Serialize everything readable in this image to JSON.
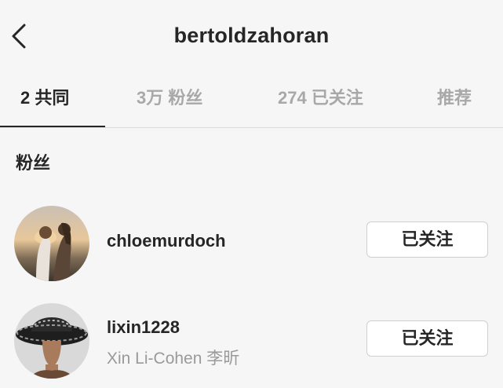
{
  "header": {
    "title": "bertoldzahoran",
    "back_icon": "chevron-left-icon"
  },
  "tabs": [
    {
      "label": "2 共同",
      "active": true
    },
    {
      "label": "3万 粉丝",
      "active": false
    },
    {
      "label": "274 已关注",
      "active": false
    },
    {
      "label": "推荐",
      "active": false
    }
  ],
  "section": {
    "title": "粉丝"
  },
  "users": [
    {
      "username": "chloemurdoch",
      "full_name": "",
      "button_label": "已关注"
    },
    {
      "username": "lixin1228",
      "full_name": "Xin Li-Cohen 李昕",
      "button_label": "已关注"
    }
  ],
  "colors": {
    "background": "#f6f6f6",
    "primary_text": "#262626",
    "secondary_text": "#a8a8a8",
    "divider": "#dbdbdb",
    "button_border": "#cfcfcf"
  }
}
